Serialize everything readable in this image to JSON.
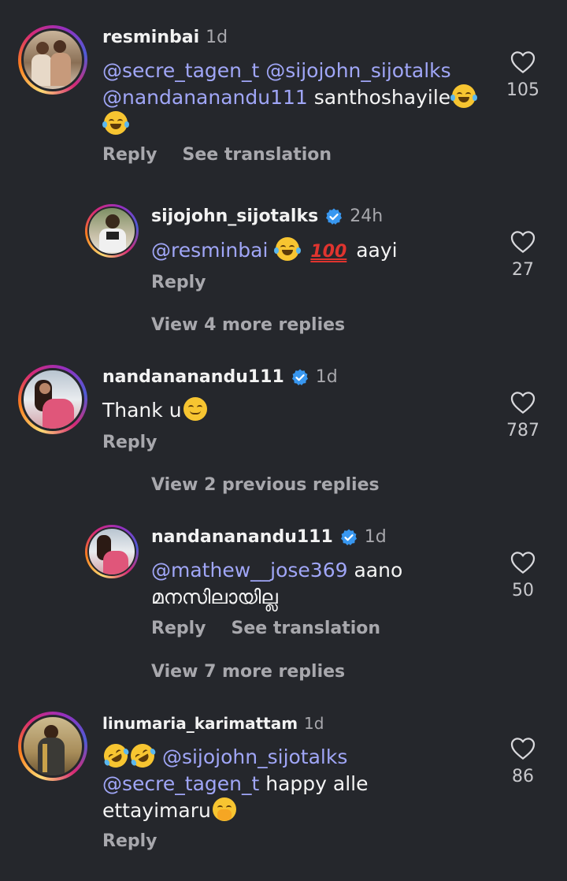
{
  "comments": [
    {
      "username": "resminbai",
      "time": "1d",
      "verified": false,
      "line1_mention1": "@secre_tagen_t",
      "line1_mention2": "@sijojohn_sijotalks",
      "line2_mention": "@nandananandu111",
      "line2_text": "santhoshayile",
      "reply_label": "Reply",
      "translate_label": "See translation",
      "likes": "105"
    },
    {
      "username": "sijojohn_sijotalks",
      "time": "24h",
      "verified": true,
      "mention": "@resminbai",
      "hundred": "100",
      "text": "aayi",
      "reply_label": "Reply",
      "likes": "27",
      "view_more": "View 4 more replies"
    },
    {
      "username": "nandananandu111",
      "time": "1d",
      "verified": true,
      "text": "Thank u",
      "reply_label": "Reply",
      "likes": "787",
      "view_previous": "View 2 previous replies"
    },
    {
      "username": "nandananandu111",
      "time": "1d",
      "verified": true,
      "mention": "@mathew__jose369",
      "text": "aano",
      "line2": "മനസിലായില്ല",
      "reply_label": "Reply",
      "translate_label": "See translation",
      "likes": "50",
      "view_more": "View 7 more replies"
    },
    {
      "username": "linumaria_karimattam",
      "time": "1d",
      "verified": false,
      "mention1": "@sijojohn_sijotalks",
      "mention2": "@secre_tagen_t",
      "text2": "happy alle",
      "text3": "ettayimaru",
      "reply_label": "Reply",
      "likes": "86"
    }
  ],
  "colors": {
    "background": "#25272c",
    "mention": "#a0a6f7",
    "muted": "#a8a8ad",
    "verified": "#3897f0"
  }
}
